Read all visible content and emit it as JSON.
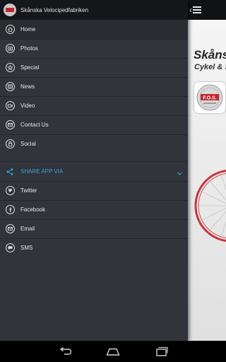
{
  "app": {
    "title": "Skånska Velocipedfabriken"
  },
  "drawer": {
    "items": [
      {
        "label": "Home",
        "icon": "home-icon",
        "active": true
      },
      {
        "label": "Photos",
        "icon": "camera-icon"
      },
      {
        "label": "Special",
        "icon": "star-icon"
      },
      {
        "label": "News",
        "icon": "news-icon"
      },
      {
        "label": "Video",
        "icon": "video-icon"
      },
      {
        "label": "Contact Us",
        "icon": "mail-icon"
      },
      {
        "label": "Social",
        "icon": "lock-icon"
      }
    ],
    "share": {
      "header": "SHARE APP VIA",
      "items": [
        {
          "label": "Twitter",
          "icon": "twitter-icon"
        },
        {
          "label": "Facebook",
          "icon": "facebook-icon"
        },
        {
          "label": "Email",
          "icon": "email-icon"
        },
        {
          "label": "SMS",
          "icon": "sms-icon"
        }
      ]
    }
  },
  "content": {
    "title": "Skåns",
    "subtitle": "Cykel & S",
    "logo_text": "F.O.S."
  },
  "colors": {
    "drawer_bg": "#31343a",
    "accent": "#3aa3d8",
    "logo_red": "#c0262c"
  }
}
